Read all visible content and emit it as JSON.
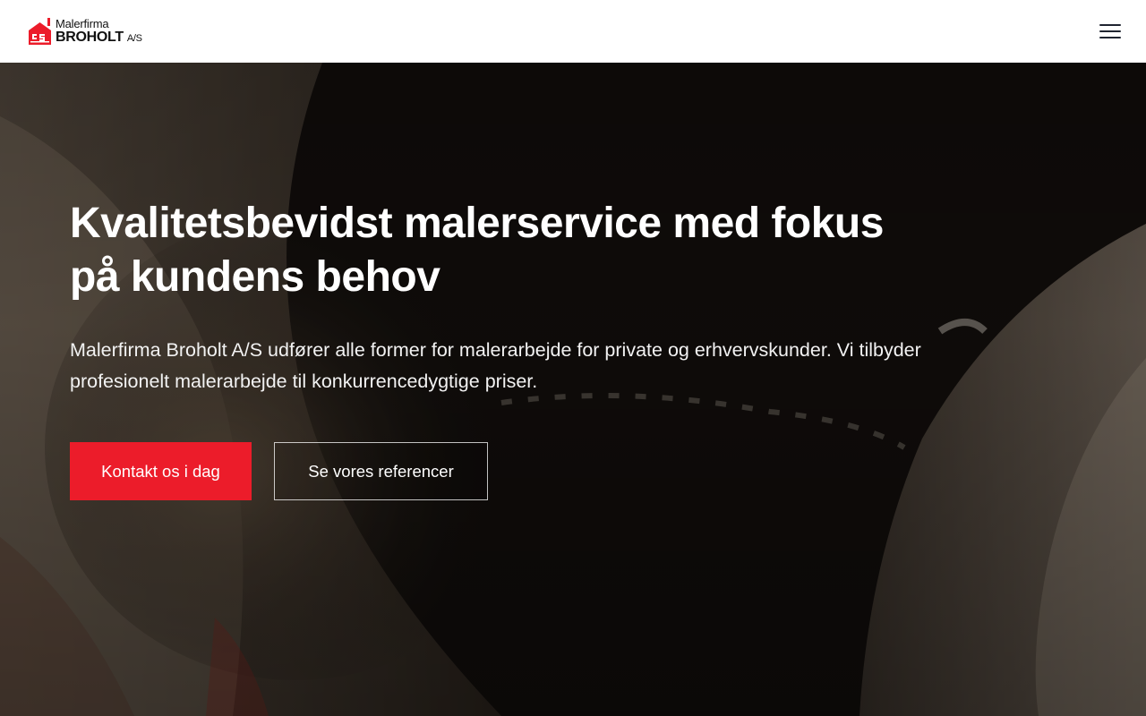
{
  "header": {
    "logo": {
      "line1": "Malerfirma",
      "line2": "BROHOLT",
      "suffix": "A/S",
      "icon": "house-paint-icon"
    },
    "menu_icon": "hamburger-menu-icon"
  },
  "hero": {
    "title": "Kvalitetsbevidst malerservice med fokus på kundens behov",
    "text": "Malerfirma Broholt A/S udfører alle former for malerarbejde for private og erhvervskunder. Vi tilbyder profesionelt malerarbejde til konkurrencedygtige priser.",
    "primary_button": "Kontakt os i dag",
    "secondary_button": "Se vores referencer"
  },
  "colors": {
    "brand_red": "#ec1c2a",
    "header_bg": "#ffffff",
    "text_light": "#ffffff"
  }
}
